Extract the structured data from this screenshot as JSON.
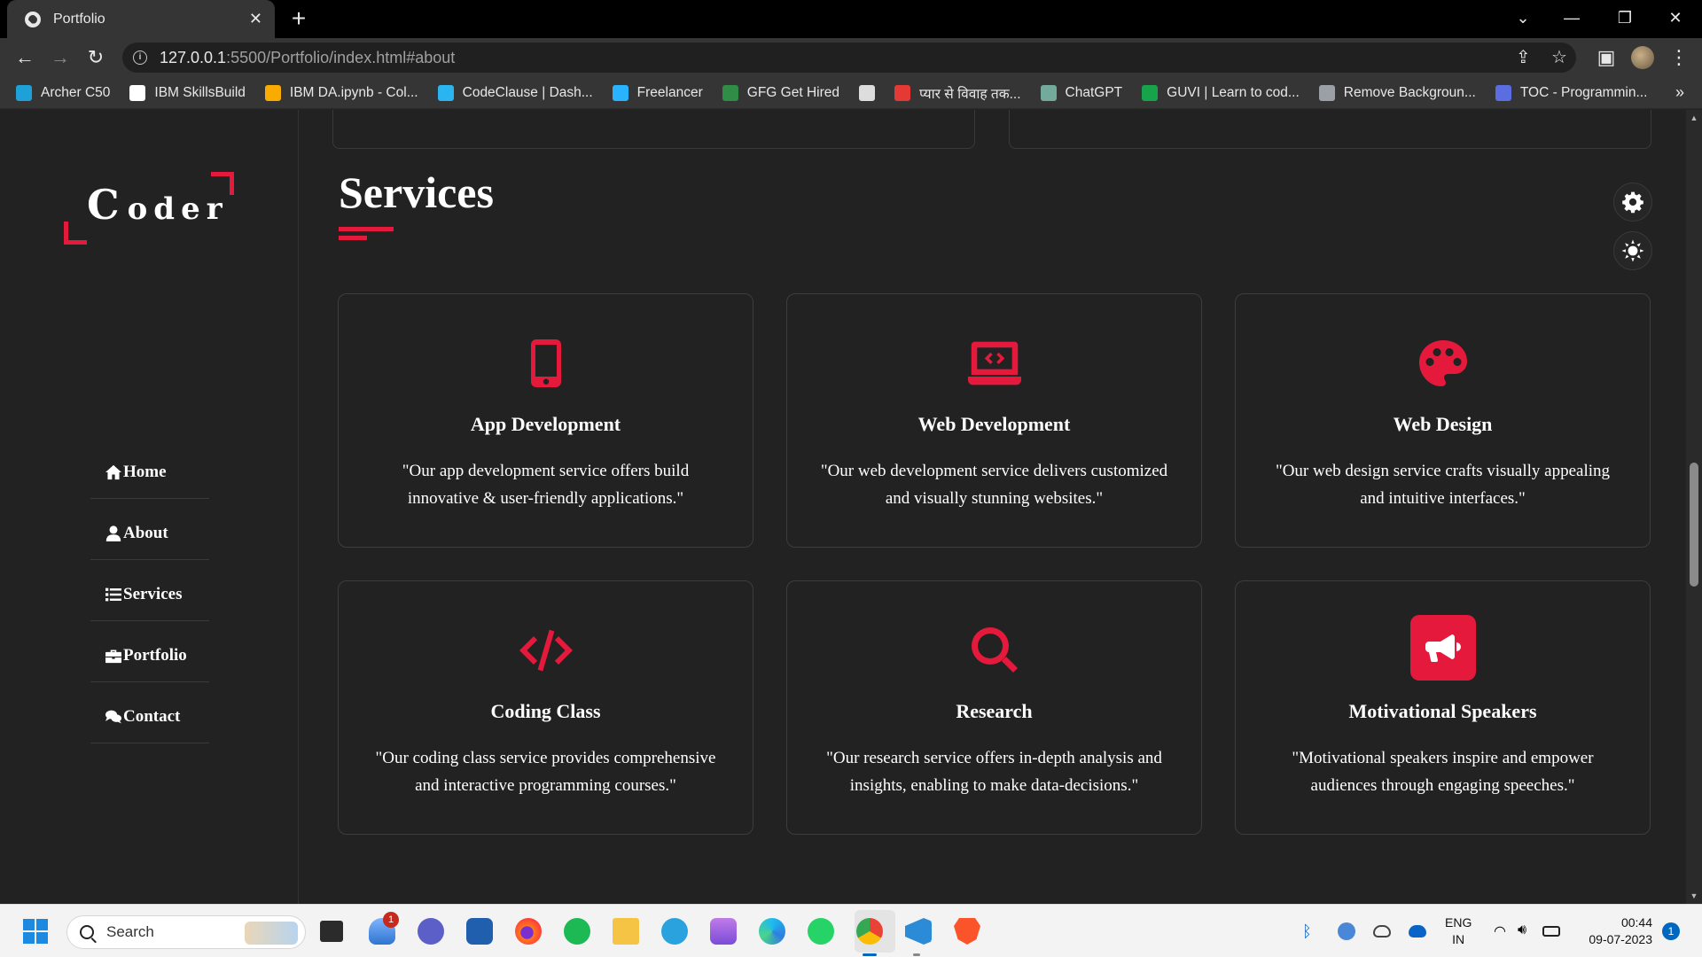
{
  "browser": {
    "tab_title": "Portfolio",
    "url_host": "127.0.0.1",
    "url_path": ":5500/Portfolio/index.html#about",
    "bookmarks": [
      {
        "label": "Archer C50",
        "color": "#1ea0d8"
      },
      {
        "label": "IBM SkillsBuild",
        "color": "#ffffff"
      },
      {
        "label": "IBM DA.ipynb - Col...",
        "color": "#f9ab00"
      },
      {
        "label": "CodeClause | Dash...",
        "color": "#2bb5f0"
      },
      {
        "label": "Freelancer",
        "color": "#29b2fe"
      },
      {
        "label": "GFG Get Hired",
        "color": "#2f8d46"
      },
      {
        "label": "",
        "color": "#dddddd"
      },
      {
        "label": "प्यार से विवाह तक...",
        "color": "#e53935"
      },
      {
        "label": "ChatGPT",
        "color": "#74aa9c"
      },
      {
        "label": "GUVI | Learn to cod...",
        "color": "#16a34a"
      },
      {
        "label": "Remove Backgroun...",
        "color": "#9aa0a6"
      },
      {
        "label": "TOC - Programmin...",
        "color": "#5b6ee1"
      }
    ]
  },
  "sidebar": {
    "logo_first": "C",
    "logo_rest": "oder",
    "nav": [
      {
        "label": "Home",
        "icon": "home-icon"
      },
      {
        "label": "About",
        "icon": "user-icon"
      },
      {
        "label": "Services",
        "icon": "list-icon"
      },
      {
        "label": "Portfolio",
        "icon": "briefcase-icon"
      },
      {
        "label": "Contact",
        "icon": "comments-icon"
      }
    ]
  },
  "main": {
    "section_title": "Services",
    "accent_color": "#e4193b",
    "services": [
      {
        "title": "App Development",
        "icon": "mobile-icon",
        "desc": "\"Our app development service offers build innovative & user-friendly applications.\""
      },
      {
        "title": "Web Development",
        "icon": "laptop-code-icon",
        "desc": "\"Our web development service delivers customized and visually stunning websites.\""
      },
      {
        "title": "Web Design",
        "icon": "palette-icon",
        "desc": "\"Our web design service crafts visually appealing and intuitive interfaces.\""
      },
      {
        "title": "Coding Class",
        "icon": "code-icon",
        "desc": "\"Our coding class service provides comprehensive and interactive programming courses.\""
      },
      {
        "title": "Research",
        "icon": "search-icon",
        "desc": "\"Our research service offers in-depth analysis and insights, enabling to make data-decisions.\""
      },
      {
        "title": "Motivational Speakers",
        "icon": "bullhorn-icon",
        "desc": "\"Motivational speakers inspire and empower audiences through engaging speeches.\""
      }
    ]
  },
  "taskbar": {
    "search_placeholder": "Search",
    "badge_count": "1",
    "lang_line1": "ENG",
    "lang_line2": "IN",
    "time": "00:44",
    "date": "09-07-2023",
    "notifications": "1"
  }
}
